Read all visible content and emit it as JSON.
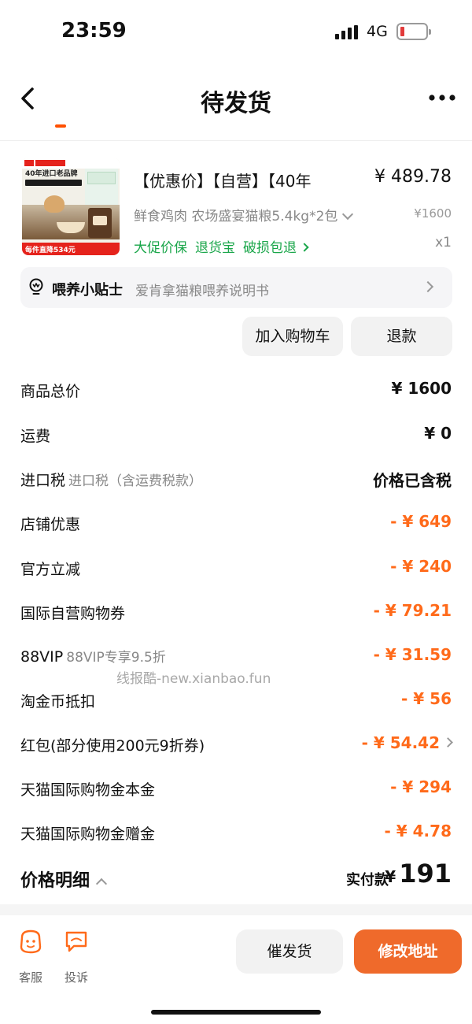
{
  "status_bar": {
    "time": "23:59",
    "network": "4G",
    "battery_color": "#e23b3b"
  },
  "nav": {
    "title": "待发货",
    "back_icon": "chevron-left-icon",
    "more_icon": "more-dots-icon"
  },
  "product": {
    "image_banner": "每件直降534元",
    "image_headline": "40年进口老品牌",
    "title": "【优惠价】【自营】【40年",
    "price": "¥ 489.78",
    "spec": "鲜食鸡肉 农场盛宴猫粮5.4kg*2包",
    "original_price": "¥1600",
    "tags": [
      "大促价保",
      "退货宝",
      "破损包退"
    ],
    "quantity": "x1"
  },
  "tips": {
    "title": "喂养小贴士",
    "description": "爱肯拿猫粮喂养说明书",
    "icon": "lightbulb-icon"
  },
  "actions": {
    "add_to_cart": "加入购物车",
    "refund": "退款"
  },
  "price_rows": [
    {
      "label": "商品总价",
      "sub": "",
      "value": "¥ 1600",
      "discount": false
    },
    {
      "label": "运费",
      "sub": "",
      "value": "¥ 0",
      "discount": false
    },
    {
      "label": "进口税",
      "sub": "进口税（含运费税款）",
      "value": "价格已含税",
      "discount": false
    },
    {
      "label": "店铺优惠",
      "sub": "",
      "value": "- ¥ 649",
      "discount": true
    },
    {
      "label": "官方立减",
      "sub": "",
      "value": "- ¥ 240",
      "discount": true
    },
    {
      "label": "国际自营购物券",
      "sub": "",
      "value": "- ¥ 79.21",
      "discount": true
    },
    {
      "label": "88VIP",
      "sub": "88VIP专享9.5折",
      "value": "- ¥ 31.59",
      "discount": true
    },
    {
      "label": "淘金币抵扣",
      "sub": "",
      "value": "- ¥ 56",
      "discount": true
    },
    {
      "label": "红包(部分使用200元9折券)",
      "sub": "",
      "value": "- ¥ 54.42",
      "discount": true
    },
    {
      "label": "天猫国际购物金本金",
      "sub": "",
      "value": "- ¥ 294",
      "discount": true
    },
    {
      "label": "天猫国际购物金赠金",
      "sub": "",
      "value": "- ¥ 4.78",
      "discount": true
    }
  ],
  "watermark": "线报酷-new.xianbao.fun",
  "summary": {
    "label": "价格明细",
    "total_label": "实付款",
    "currency": "¥",
    "total": "191"
  },
  "bottom_bar": {
    "service_label": "客服",
    "complain_label": "投诉",
    "urge_label": "催发货",
    "address_label": "修改地址",
    "accent_color": "#ef6a2b",
    "discount_color": "#ff6a1a"
  }
}
